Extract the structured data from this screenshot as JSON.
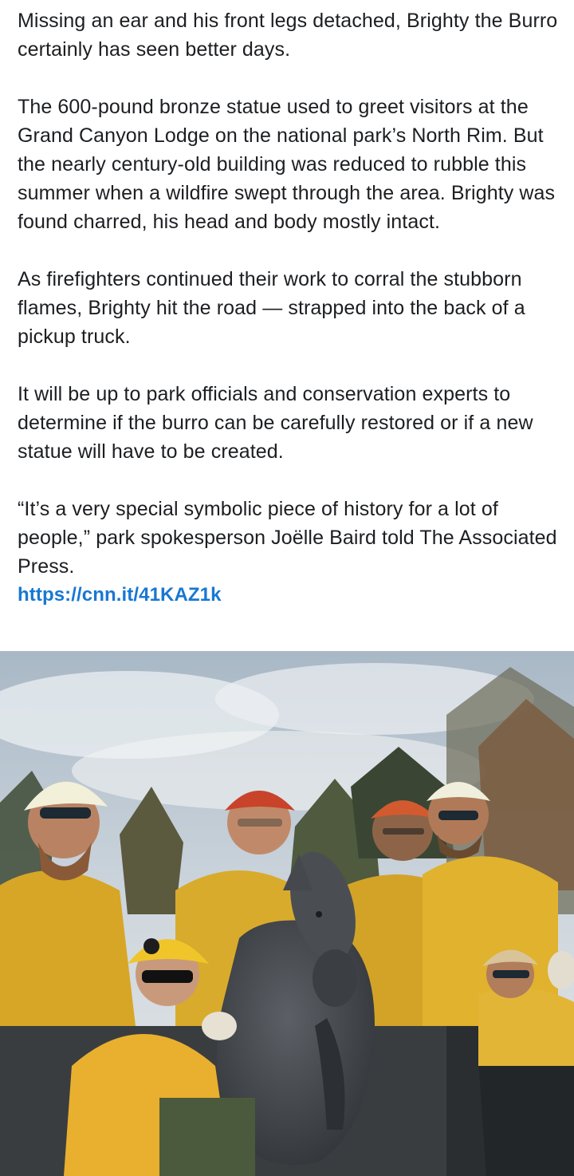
{
  "post": {
    "paragraphs": [
      "Missing an ear and his front legs detached, Brighty the Burro certainly has seen better days.",
      "The 600-pound bronze statue used to greet visitors at the Grand Canyon Lodge on the national park’s North Rim. But the nearly century-old building was reduced to rubble this summer when a wildfire swept through the area. Brighty was found charred, his head and body mostly intact.",
      "As firefighters continued their work to corral the stubborn flames, Brighty hit the road — strapped into the back of a pickup truck.",
      "It will be up to park officials and conservation experts to determine if the burro can be carefully restored or if a new statue will have to be created.",
      "“It’s a very special symbolic piece of history for a lot of people,” park spokesperson Joëlle Baird told The Associated Press."
    ],
    "link": "https://cnn.it/41KAZ1k",
    "link_color": "#1877d2"
  },
  "photo": {
    "subject": "firefighters-with-burro-statue-photo"
  }
}
